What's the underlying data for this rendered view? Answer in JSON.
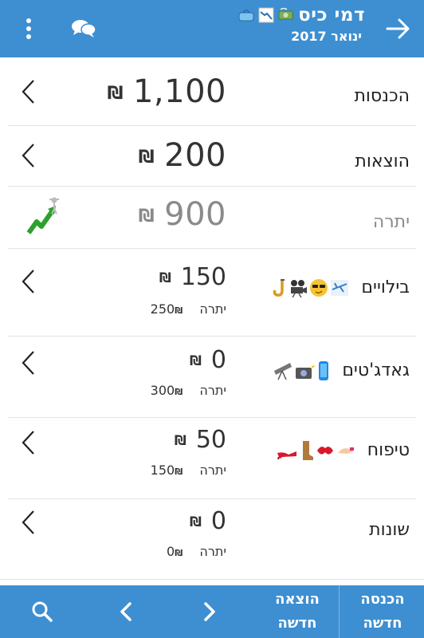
{
  "header": {
    "title": "דמי כיס",
    "subtitle": "ינואר 2017",
    "title_icons": [
      "money-with-wings-icon",
      "chart-decreasing-icon",
      "purse-icon"
    ],
    "back_icon": "arrow-right-icon",
    "chat_icon": "chat-bubbles-icon",
    "menu_icon": "more-vertical-icon"
  },
  "summary": {
    "income": {
      "label": "הכנסות",
      "amount": "1,100",
      "currency": "₪"
    },
    "expenses": {
      "label": "הוצאות",
      "amount": "200",
      "currency": "₪"
    },
    "balance": {
      "label": "יתרה",
      "amount": "900",
      "currency": "₪",
      "icon": "trending-up-icon"
    }
  },
  "categories": [
    {
      "label": "בילויים",
      "amount": "150",
      "currency": "₪",
      "balance_label": "יתרה",
      "balance": "250",
      "icons": [
        "saxophone-icon",
        "movie-camera-icon",
        "sunglasses-face-icon",
        "airplane-icon"
      ]
    },
    {
      "label": "גאדג'טים",
      "amount": "0",
      "currency": "₪",
      "balance_label": "יתרה",
      "balance": "300",
      "icons": [
        "telescope-icon",
        "camera-flash-icon",
        "mobile-phone-icon"
      ]
    },
    {
      "label": "טיפוח",
      "amount": "50",
      "currency": "₪",
      "balance_label": "יתרה",
      "balance": "150",
      "icons": [
        "high-heel-icon",
        "boots-icon",
        "kiss-mark-icon",
        "nail-polish-icon"
      ]
    },
    {
      "label": "שונות",
      "amount": "0",
      "currency": "₪",
      "balance_label": "יתרה",
      "balance": "0",
      "icons": []
    }
  ],
  "bottom_bar": {
    "new_income_line1": "הכנסה",
    "new_income_line2": "חדשה",
    "new_expense_line1": "הוצאה",
    "new_expense_line2": "חדשה",
    "next_icon": "chevron-right-icon",
    "prev_icon": "chevron-left-icon",
    "search_icon": "search-icon"
  },
  "colors": {
    "primary": "#3d8fd1",
    "muted": "#8a8a8a",
    "up_arrow": "#2da02d"
  }
}
